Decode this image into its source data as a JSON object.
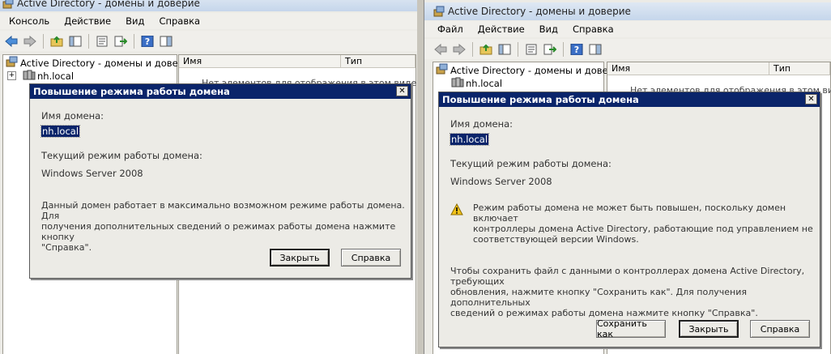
{
  "left": {
    "title": "Active Directory - домены и доверие",
    "menu": [
      "Консоль",
      "Действие",
      "Вид",
      "Справка"
    ],
    "tree": {
      "root": "Active Directory - домены и доверие [",
      "domain": "nh.local"
    },
    "columns": [
      "Имя",
      "Тип"
    ],
    "empty_text": "Нет элементов для отображения в этом виде.",
    "dialog": {
      "title": "Повышение режима работы домена",
      "domain_label": "Имя домена:",
      "domain_value": "nh.local",
      "level_label": "Текущий режим работы домена:",
      "level_value": "Windows Server 2008",
      "message_lines": [
        "Данный домен работает в максимально возможном режиме работы домена. Для",
        "получения дополнительных сведений о режимах работы домена нажмите кнопку",
        "\"Справка\"."
      ],
      "close_button": "Закрыть",
      "help_button": "Справка"
    }
  },
  "right": {
    "title": "Active Directory - домены и доверие",
    "menu": [
      "Файл",
      "Действие",
      "Вид",
      "Справка"
    ],
    "tree": {
      "root": "Active Directory - домены и доверие [",
      "domain": "nh.local"
    },
    "columns": [
      "Имя",
      "Тип"
    ],
    "empty_text": "Нет элементов для отображения в этом виде.",
    "dialog": {
      "title": "Повышение режима работы домена",
      "domain_label": "Имя домена:",
      "domain_value": "nh.local",
      "level_label": "Текущий режим работы домена:",
      "level_value": "Windows Server 2008",
      "warning_lines": [
        "Режим работы домена не может быть повышен, поскольку домен включает",
        "контроллеры домена Active Directory, работающие под управлением не",
        "соответствующей версии Windows."
      ],
      "info_lines": [
        "Чтобы сохранить файл с данными о контроллерах домена Active Directory, требующих",
        "обновления, нажмите кнопку \"Сохранить как\". Для получения дополнительных",
        "сведений о режимах работы домена нажмите кнопку \"Справка\"."
      ],
      "save_button": "Сохранить как",
      "close_button": "Закрыть",
      "help_button": "Справка"
    }
  }
}
